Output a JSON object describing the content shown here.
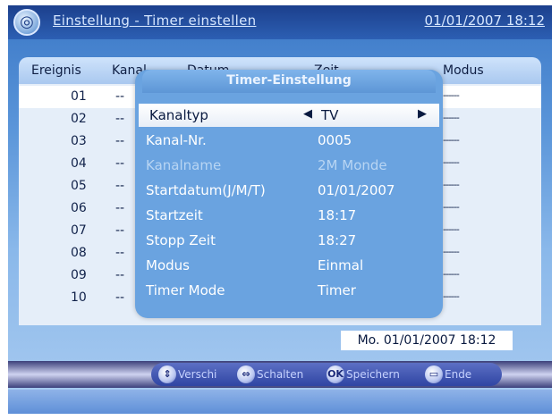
{
  "header": {
    "title": "Einstellung - Timer einstellen",
    "datetime": "01/01/2007 18:12",
    "icon": "globe-icon"
  },
  "table": {
    "columns": [
      "Ereignis",
      "Kanal",
      "Datum",
      "Zeit",
      "Modus"
    ],
    "rows": [
      {
        "num": "01",
        "channel": "--",
        "mode": "------"
      },
      {
        "num": "02",
        "channel": "--",
        "mode": "------"
      },
      {
        "num": "03",
        "channel": "--",
        "mode": "------"
      },
      {
        "num": "04",
        "channel": "--",
        "mode": "------"
      },
      {
        "num": "05",
        "channel": "--",
        "mode": "------"
      },
      {
        "num": "06",
        "channel": "--",
        "mode": "------"
      },
      {
        "num": "07",
        "channel": "--",
        "mode": "------"
      },
      {
        "num": "08",
        "channel": "--",
        "mode": "------"
      },
      {
        "num": "09",
        "channel": "--",
        "mode": "------"
      },
      {
        "num": "10",
        "channel": "--",
        "mode": "------"
      }
    ]
  },
  "dialog": {
    "title": "Timer-Einstellung",
    "fields": [
      {
        "label": "Kanaltyp",
        "value": "TV"
      },
      {
        "label": "Kanal-Nr.",
        "value": "0005"
      },
      {
        "label": "Kanalname",
        "value": "2M Monde"
      },
      {
        "label": "Startdatum(J/M/T)",
        "value": "01/01/2007"
      },
      {
        "label": "Startzeit",
        "value": "18:17"
      },
      {
        "label": "Stopp Zeit",
        "value": "18:27"
      },
      {
        "label": "Modus",
        "value": "Einmal"
      },
      {
        "label": "Timer Mode",
        "value": "Timer"
      }
    ]
  },
  "status": {
    "date": "Mo. 01/01/2007 18:12"
  },
  "footer": {
    "items": [
      {
        "icon": "up-down-arrow-icon",
        "label": "Verschi"
      },
      {
        "icon": "left-right-arrow-icon",
        "label": "Schalten"
      },
      {
        "icon": "ok-icon",
        "label": "Speichern"
      },
      {
        "icon": "exit-icon",
        "label": "Ende"
      }
    ]
  },
  "colors": {
    "background": "#5a95d9",
    "header": "#1c3f8c",
    "dialog": "#6aa3e0",
    "highlight": "#ffffff"
  }
}
